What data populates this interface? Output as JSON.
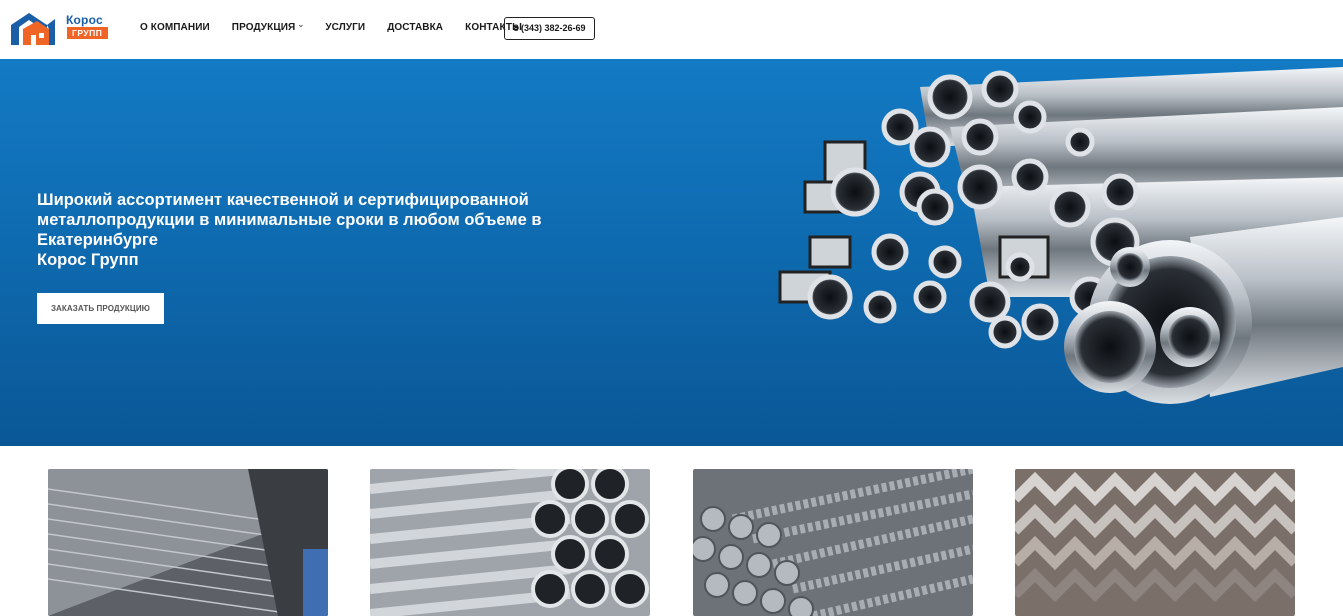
{
  "header": {
    "logo": {
      "line1": "Корос",
      "line2": "ГРУПП"
    },
    "nav": [
      {
        "label": "О компании"
      },
      {
        "label": "Продукция"
      },
      {
        "label": "Услуги"
      },
      {
        "label": "Доставка"
      },
      {
        "label": "Контакты"
      }
    ],
    "phone": "8 (343) 382-26-69"
  },
  "hero": {
    "title_lines": [
      "Широкий ассортимент качественной и сертифицированной",
      "металлопродукции в минимальные сроки в любом объеме в",
      "Екатеринбурге",
      "Корос Групп"
    ],
    "cta_label": "ЗАКАЗАТЬ ПРОДУКЦИЮ"
  },
  "products": [
    {
      "icon": "metal-sheets-image"
    },
    {
      "icon": "pipes-image"
    },
    {
      "icon": "rebar-image"
    },
    {
      "icon": "angle-steel-image"
    }
  ],
  "colors": {
    "brand_blue": "#1b5ea8",
    "brand_orange": "#f06426",
    "hero_blue": "#0f6db3"
  }
}
